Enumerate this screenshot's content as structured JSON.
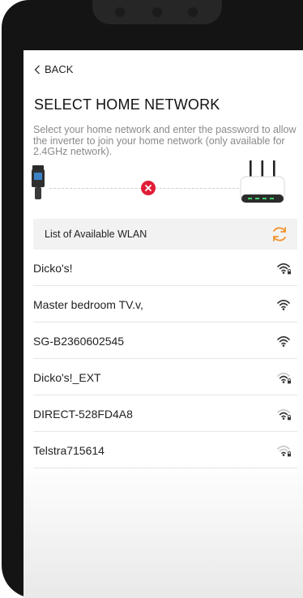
{
  "nav": {
    "back_label": "BACK"
  },
  "page": {
    "title": "SELECT HOME NETWORK",
    "instructions": "Select your home network and enter the password to allow the inverter to join your home network (only available for 2.4GHz network)."
  },
  "diagram": {
    "status": "error",
    "status_color": "#e01e37"
  },
  "wlan": {
    "header_label": "List of Available WLAN",
    "refresh_icon": "refresh-icon",
    "refresh_color": "#f2922f",
    "networks": [
      {
        "name": "Dicko's!",
        "locked": true,
        "strength": 3
      },
      {
        "name": "Master bedroom TV.v,",
        "locked": false,
        "strength": 3
      },
      {
        "name": "SG-B2360602545",
        "locked": false,
        "strength": 3
      },
      {
        "name": "Dicko's!_EXT",
        "locked": true,
        "strength": 2
      },
      {
        "name": "DIRECT-528FD4A8",
        "locked": true,
        "strength": 2
      },
      {
        "name": "Telstra715614",
        "locked": true,
        "strength": 1
      }
    ]
  }
}
